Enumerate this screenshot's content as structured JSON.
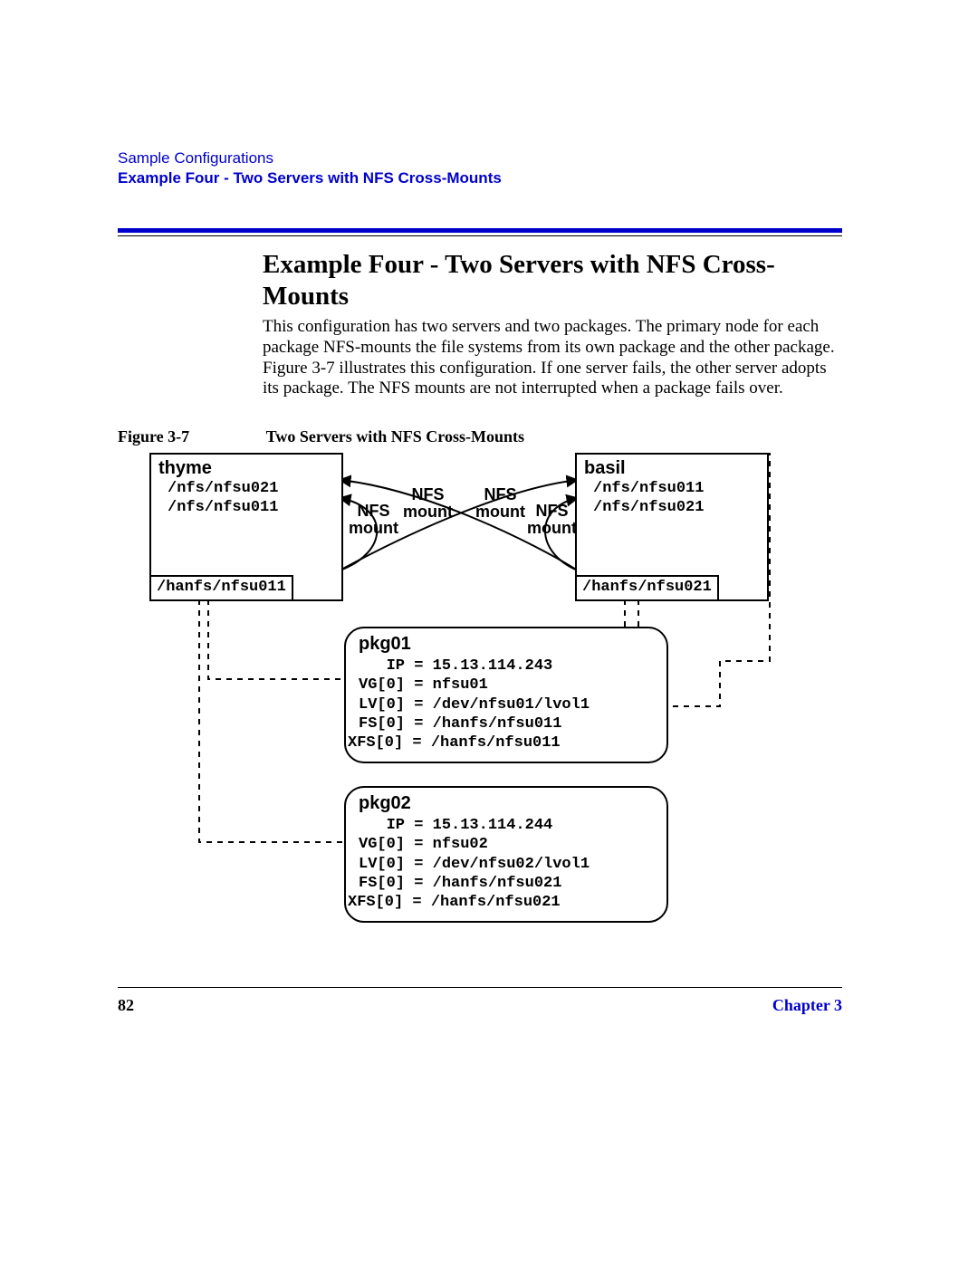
{
  "header": {
    "section": "Sample Configurations",
    "subtitle": "Example Four - Two Servers with NFS Cross-Mounts"
  },
  "title": "Example Four - Two Servers with NFS Cross-Mounts",
  "paragraph": "This configuration has two servers and two packages. The primary node for each package NFS-mounts the file systems from its own package and the other package. Figure 3-7 illustrates this configuration. If one server fails, the other server adopts its package. The NFS mounts are not interrupted when a package fails over.",
  "figure": {
    "label": "Figure 3-7",
    "title": "Two Servers with NFS Cross-Mounts"
  },
  "diagram": {
    "thyme": {
      "name": "thyme",
      "path1": "/nfs/nfsu021",
      "path2": "/nfs/nfsu011",
      "hanfs": "/hanfs/nfsu011"
    },
    "basil": {
      "name": "basil",
      "path1": "/nfs/nfsu011",
      "path2": "/nfs/nfsu021",
      "hanfs": "/hanfs/nfsu021"
    },
    "mount_labels": {
      "nfs_mount_1": "NFS\nmount",
      "nfs_mount_2": "NFS\nmount",
      "nfs_mount_3": "NFS\nmount",
      "nfs_mount_4": "NFS\nmount"
    },
    "pkg01": {
      "title": "pkg01",
      "ip": "   IP = 15.13.114.243",
      "vg": "VG[0] = nfsu01",
      "lv": "LV[0] = /dev/nfsu01/lvol1",
      "fs": "FS[0] = /hanfs/nfsu011",
      "xfs": "XFS[0] = /hanfs/nfsu011"
    },
    "pkg02": {
      "title": "pkg02",
      "ip": "   IP = 15.13.114.244",
      "vg": "VG[0] = nfsu02",
      "lv": "LV[0] = /dev/nfsu02/lvol1",
      "fs": "FS[0] = /hanfs/nfsu021",
      "xfs": "XFS[0] = /hanfs/nfsu021"
    }
  },
  "footer": {
    "page": "82",
    "chapter": "Chapter 3"
  }
}
